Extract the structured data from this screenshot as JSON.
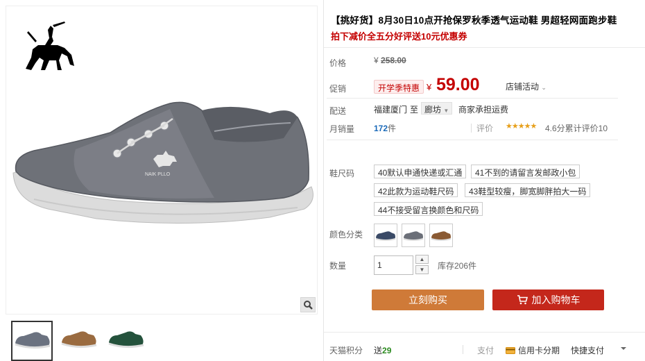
{
  "product": {
    "title": "【挑好货】8月30日10点开抢保罗秋季透气运动鞋 男超轻网面跑步鞋",
    "subtitle": "拍下减价全五分好评送10元优惠券",
    "brand_text": "NAIK PLLO"
  },
  "price": {
    "label": "价格",
    "currency": "¥",
    "original": "258.00",
    "promo_label": "促销",
    "promo_badge": "开学季特惠",
    "current": "59.00",
    "shop_activity": "店铺活动"
  },
  "shipping": {
    "label": "配送",
    "from": "福建厦门",
    "to_word": "至",
    "to": "廊坊",
    "fee": "商家承担运费"
  },
  "stats": {
    "sales_label": "月销量",
    "sales_count": "172",
    "sales_unit": "件",
    "review_label": "评价",
    "rating": 4.6,
    "stars_glyphs": "★★★★★",
    "review_text": "4.6分累计评价10"
  },
  "sizes": {
    "label": "鞋尺码",
    "options": [
      "40默认申通快递或汇通",
      "41不到的请留言发邮政小包",
      "42此款为运动鞋尺码",
      "43鞋型较瘦，脚宽脚胖拍大一码",
      "44不接受留言换颜色和尺码"
    ]
  },
  "colors": {
    "label": "颜色分类",
    "swatches": [
      "#3a4a66",
      "#6b6f78",
      "#8a5a33"
    ]
  },
  "quantity": {
    "label": "数量",
    "value": "1",
    "stock": "库存206件"
  },
  "actions": {
    "buy_now": "立刻购买",
    "add_to_cart": "加入购物车"
  },
  "footer": {
    "points_label": "天猫积分",
    "points_prefix": "送",
    "points_value": "29",
    "pay_label": "支付",
    "pay_card": "信用卡分期",
    "pay_quick": "快捷支付"
  },
  "thumbnails": [
    {
      "color": "#6b7280"
    },
    {
      "color": "#9a6b40"
    },
    {
      "color": "#24523c"
    }
  ],
  "theme": {
    "accent_red": "#c40000",
    "buy_orange": "#cf7a38",
    "cart_red": "#c4271b",
    "sales_blue": "#1b6ab9",
    "points_green": "#2b8a1f"
  }
}
